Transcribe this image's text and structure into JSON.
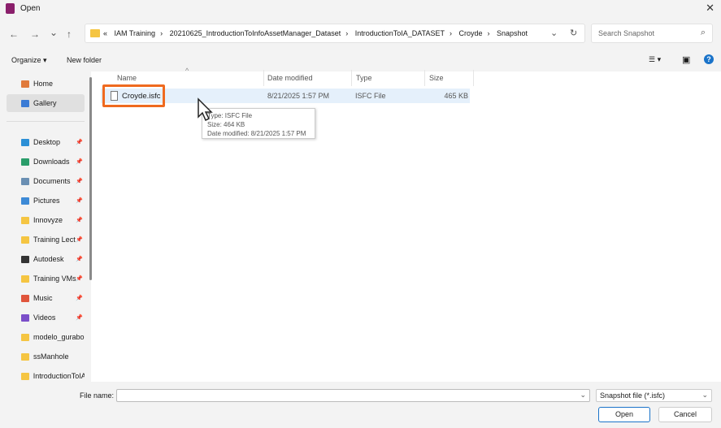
{
  "window": {
    "title": "Open",
    "close": "✕"
  },
  "nav": {
    "back": "←",
    "forward": "→",
    "recent": "⌄",
    "up": "↑"
  },
  "address": {
    "overflow": "«",
    "crumbs": [
      "IAM Training",
      "20210625_IntroductionToInfoAssetManager_Dataset",
      "IntroductionToIA_DATASET",
      "Croyde",
      "Snapshot"
    ],
    "sep": "›",
    "dropdown": "⌄",
    "refresh": "↻"
  },
  "search": {
    "placeholder": "Search Snapshot",
    "icon": "⌕"
  },
  "toolbar": {
    "organize": "Organize ▾",
    "new_folder": "New folder",
    "view": "☰ ▾",
    "preview": "▣",
    "help": "?"
  },
  "sidebar": {
    "items": [
      {
        "label": "Home",
        "icon": "home",
        "color": "#e07a3c",
        "pinned": false
      },
      {
        "label": "Gallery",
        "icon": "gallery",
        "color": "#3a7bd5",
        "pinned": false,
        "selected": true
      },
      {
        "label": "Desktop",
        "icon": "desktop",
        "color": "#2b8fd6",
        "pinned": true
      },
      {
        "label": "Downloads",
        "icon": "download",
        "color": "#2a9d6a",
        "pinned": true
      },
      {
        "label": "Documents",
        "icon": "documents",
        "color": "#6a8fb3",
        "pinned": true
      },
      {
        "label": "Pictures",
        "icon": "pictures",
        "color": "#3d8ad6",
        "pinned": true
      },
      {
        "label": "Innovyze",
        "icon": "folder",
        "color": "#f5c542",
        "pinned": true
      },
      {
        "label": "Training Lect",
        "icon": "folder",
        "color": "#f5c542",
        "pinned": true
      },
      {
        "label": "Autodesk",
        "icon": "autodesk",
        "color": "#333333",
        "pinned": true
      },
      {
        "label": "Training VMs",
        "icon": "folder",
        "color": "#f5c542",
        "pinned": true
      },
      {
        "label": "Music",
        "icon": "music",
        "color": "#e0553c",
        "pinned": true
      },
      {
        "label": "Videos",
        "icon": "videos",
        "color": "#7b4fc9",
        "pinned": true
      },
      {
        "label": "modelo_gurabo",
        "icon": "folder",
        "color": "#f5c542",
        "pinned": false
      },
      {
        "label": "ssManhole",
        "icon": "folder",
        "color": "#f5c542",
        "pinned": false
      },
      {
        "label": "IntroductionToIA",
        "icon": "folder",
        "color": "#f5c542",
        "pinned": false
      }
    ],
    "pin": "📌"
  },
  "columns": {
    "name": "Name",
    "date": "Date modified",
    "type": "Type",
    "size": "Size"
  },
  "files": [
    {
      "name": "Croyde.isfc",
      "date": "8/21/2025 1:57 PM",
      "type": "ISFC File",
      "size": "465 KB"
    }
  ],
  "tooltip": {
    "line1": "Type: ISFC File",
    "line2": "Size: 464 KB",
    "line3": "Date modified: 8/21/2025 1:57 PM"
  },
  "highlight_color": "#ef6a1f",
  "footer": {
    "file_name_label": "File name:",
    "file_name_value": "",
    "filter": "Snapshot file (*.isfc)",
    "open": "Open",
    "cancel": "Cancel"
  }
}
